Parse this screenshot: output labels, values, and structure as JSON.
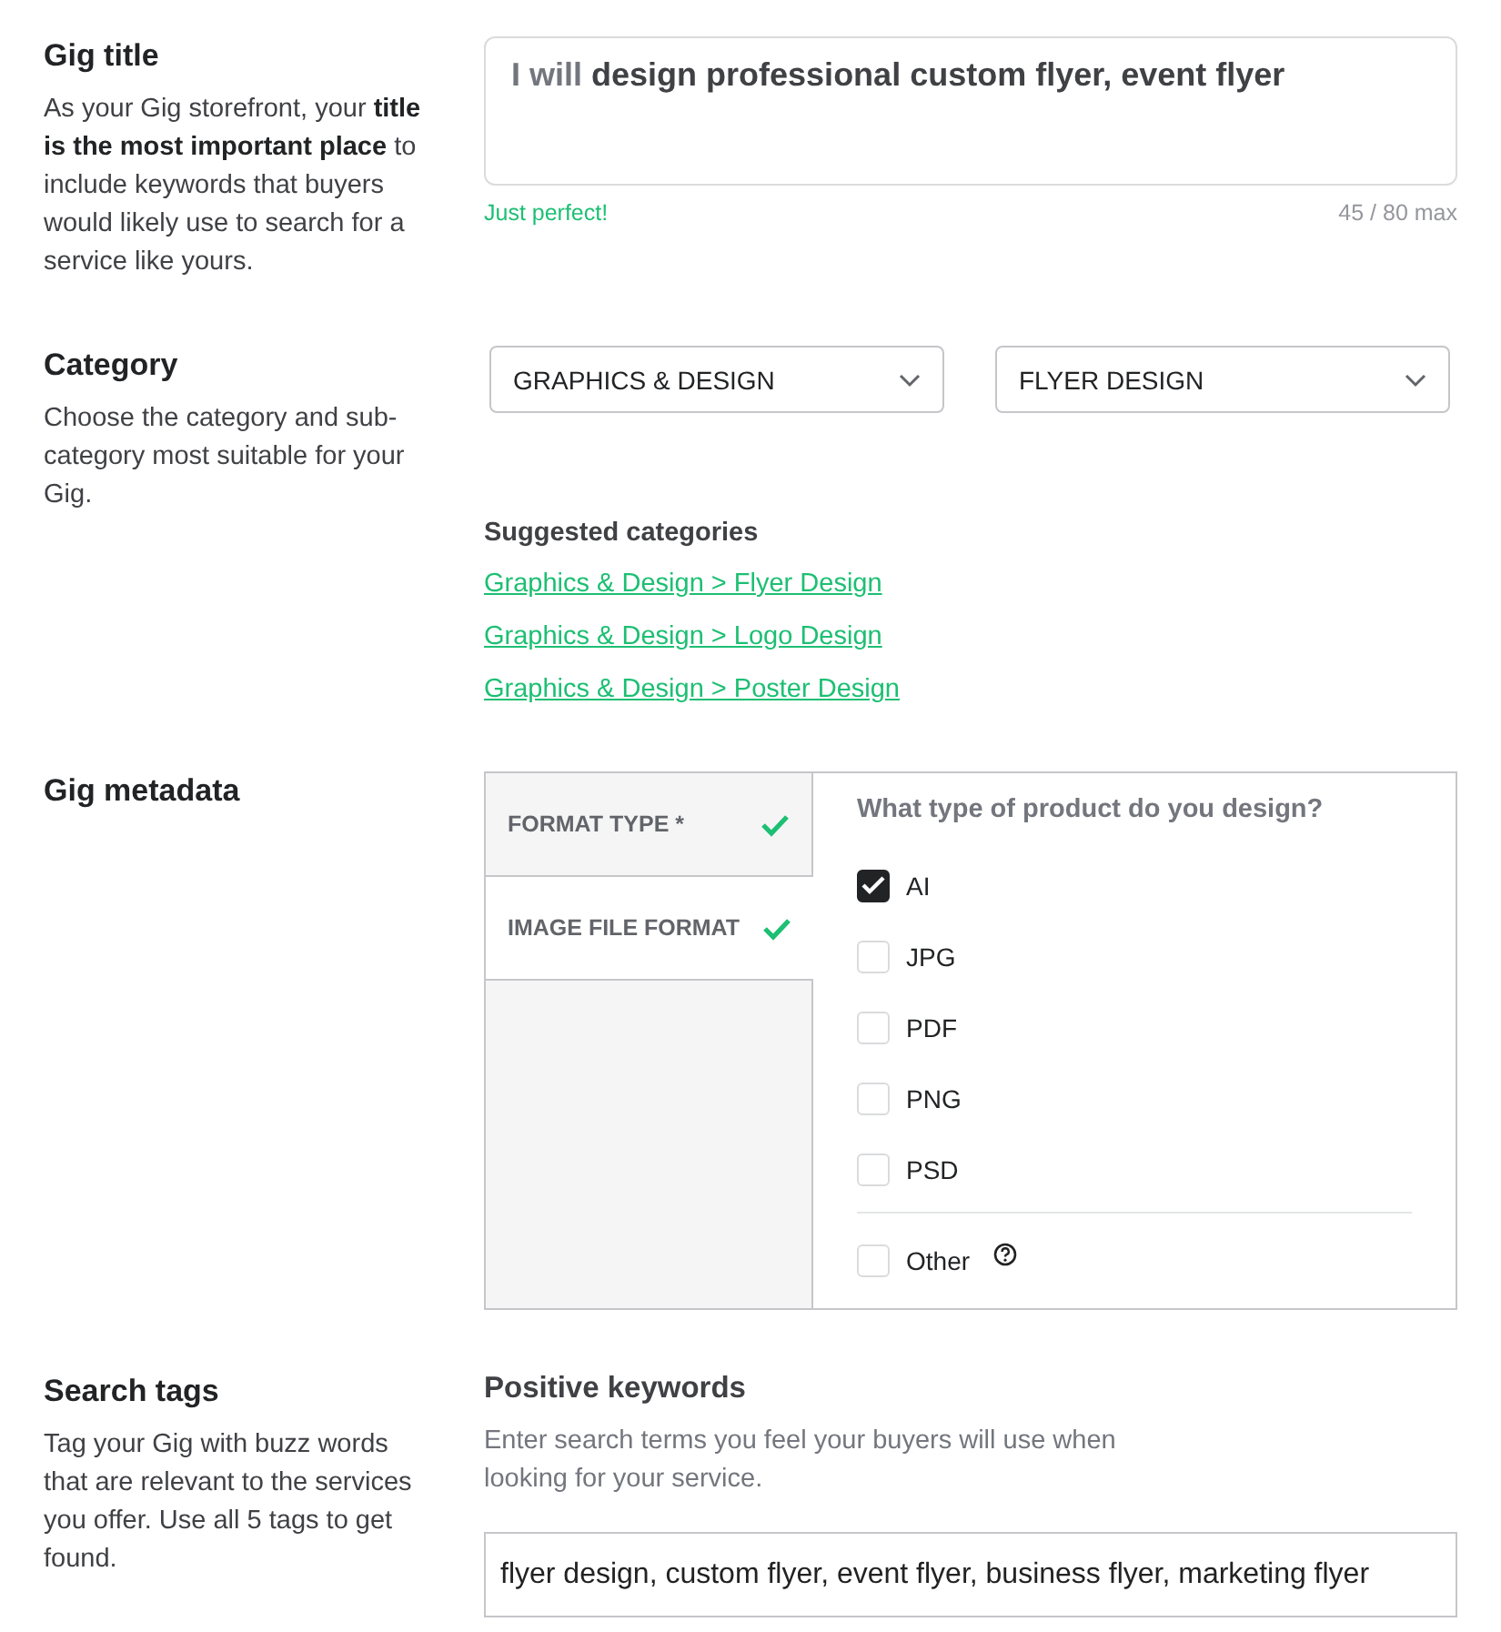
{
  "sections": [
    {
      "kind": "title",
      "heading": "Gig title",
      "description": "As your Gig storefront, your **title is the most important place** to include keywords that buyers would likely use to search for a service like yours.",
      "field": {
        "prefix": "I will",
        "value": "design professional custom flyer, event flyer"
      },
      "status": "Just perfect!",
      "counter": "45 / 80 max"
    },
    {
      "kind": "category",
      "heading": "Category",
      "description": "Choose the category and sub-category most suitable for your Gig.",
      "dropdowns": [
        "GRAPHICS & DESIGN",
        "FLYER DESIGN"
      ],
      "suggested_heading": "Suggested categories",
      "suggestions": [
        "Graphics & Design > Flyer Design",
        "Graphics & Design > Logo Design",
        "Graphics & Design > Poster Design"
      ]
    },
    {
      "kind": "metadata",
      "heading": "Gig metadata",
      "tabs": [
        {
          "label": "FORMAT TYPE *",
          "selected": false,
          "complete": true
        },
        {
          "label": "IMAGE FILE FORMAT",
          "selected": true,
          "complete": true
        }
      ],
      "question": "What type of product do you design?",
      "options": [
        {
          "kind": "option",
          "label": "AI",
          "checked": true
        },
        {
          "kind": "option",
          "label": "JPG",
          "checked": false
        },
        {
          "kind": "option",
          "label": "PDF",
          "checked": false
        },
        {
          "kind": "option",
          "label": "PNG",
          "checked": false
        },
        {
          "kind": "option",
          "label": "PSD",
          "checked": false
        },
        {
          "kind": "other",
          "label": "Other",
          "checked": false
        }
      ]
    },
    {
      "kind": "tags",
      "heading": "Search tags",
      "description": "Tag your Gig with buzz words that are relevant to the services you offer. Use all 5 tags to get found.",
      "subheading": "Positive keywords",
      "hint": "Enter search terms you feel your buyers will use when looking for your service.",
      "field": {
        "value": "flyer design, custom flyer, event flyer, business flyer, marketing flyer"
      }
    }
  ]
}
